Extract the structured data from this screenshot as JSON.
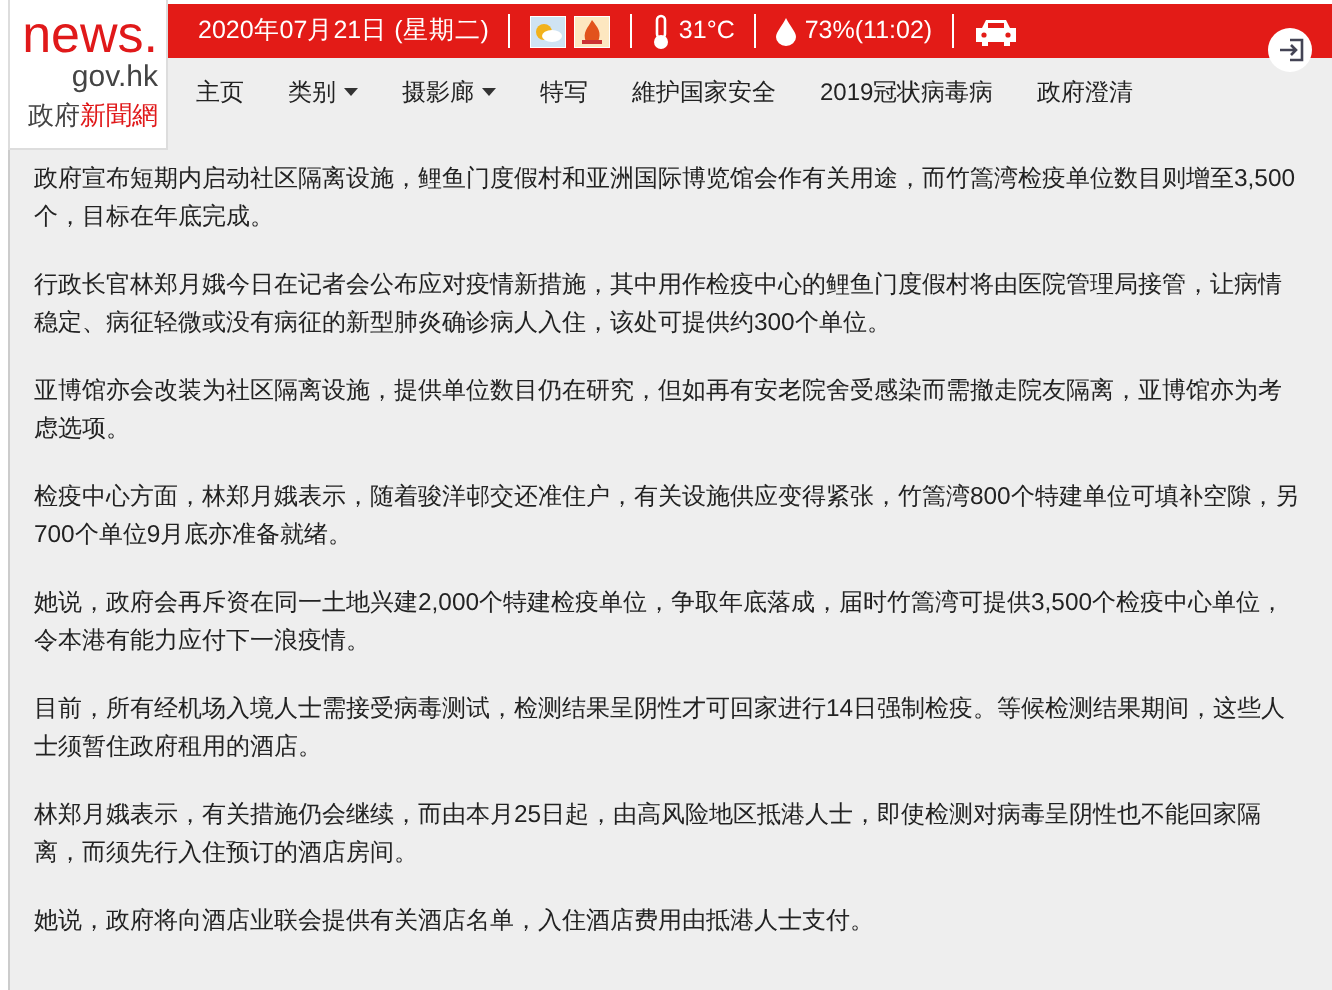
{
  "logo": {
    "line_1": "news.",
    "line_2": "gov.hk",
    "line_3": [
      {
        "text": "政府",
        "kind": "plain"
      },
      {
        "text": "新聞網",
        "kind": "accent"
      }
    ]
  },
  "top_bar": {
    "date": "2020年07月21日 (星期二)",
    "temperature": "31°C",
    "humidity": "73%(11:02)"
  },
  "nav": [
    {
      "label": "主页",
      "dropdown": false
    },
    {
      "label": "类别",
      "dropdown": true
    },
    {
      "label": "摄影廊",
      "dropdown": true
    },
    {
      "label": "特写",
      "dropdown": false
    },
    {
      "label": "維护国家安全",
      "dropdown": false
    },
    {
      "label": "2019冠状病毒病",
      "dropdown": false
    },
    {
      "label": "政府澄清",
      "dropdown": false
    }
  ],
  "article": {
    "paragraphs": [
      "政府宣布短期内启动社区隔离设施，鲤鱼门度假村和亚洲国际博览馆会作有关用途，而竹篙湾检疫单位数目则增至3,500个，目标在年底完成。",
      "行政长官林郑月娥今日在记者会公布应对疫情新措施，其中用作检疫中心的鲤鱼门度假村将由医院管理局接管，让病情稳定、病征轻微或没有病征的新型肺炎确诊病人入住，该处可提供约300个单位。",
      "亚博馆亦会改装为社区隔离设施，提供单位数目仍在研究，但如再有安老院舍受感染而需撤走院友隔离，亚博馆亦为考虑选项。",
      "检疫中心方面，林郑月娥表示，随着骏洋邨交还准住户，有关设施供应变得紧张，竹篙湾800个特建单位可填补空隙，另700个单位9月底亦准备就绪。",
      "她说，政府会再斥资在同一土地兴建2,000个特建检疫单位，争取年底落成，届时竹篙湾可提供3,500个检疫中心单位，令本港有能力应付下一浪疫情。",
      "目前，所有经机场入境人士需接受病毒测试，检测结果呈阴性才可回家进行14日强制检疫。等候检测结果期间，这些人士须暂住政府租用的酒店。",
      "林郑月娥表示，有关措施仍会继续，而由本月25日起，由高风险地区抵港人士，即使检测对病毒呈阴性也不能回家隔离，而须先行入住预订的酒店房间。",
      "她说，政府将向酒店业联会提供有关酒店名单，入住酒店费用由抵港人士支付。"
    ]
  }
}
